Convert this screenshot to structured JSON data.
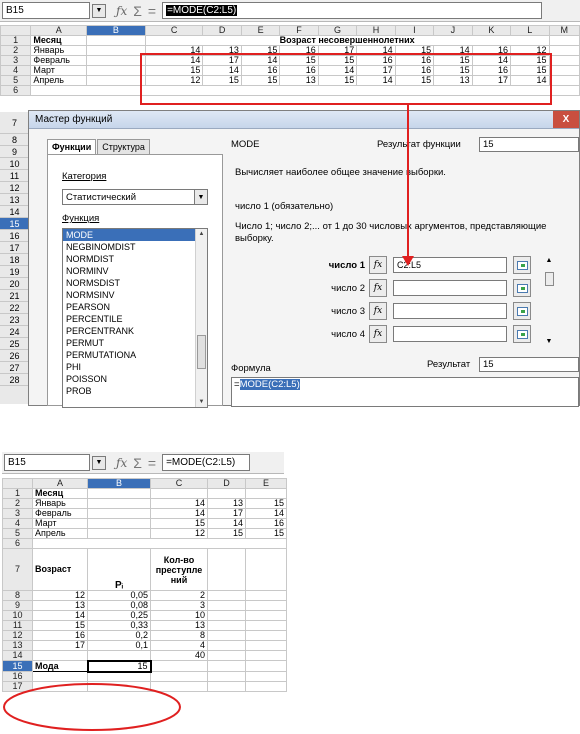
{
  "top_sheet": {
    "cell_ref": "B15",
    "formula": "=MODE(C2:L5)",
    "columns": [
      "A",
      "B",
      "C",
      "D",
      "E",
      "F",
      "G",
      "H",
      "I",
      "J",
      "K",
      "L",
      "M"
    ],
    "row_numbers": [
      "1",
      "2",
      "3",
      "4",
      "5",
      "6",
      "7",
      "8",
      "9",
      "10",
      "11",
      "12",
      "13",
      "14",
      "15",
      "16",
      "17",
      "18",
      "19",
      "20",
      "21",
      "22",
      "23",
      "24",
      "25",
      "26",
      "27",
      "28"
    ],
    "header_a1": "Месяц",
    "header_merged": "Возраст несовершеннолетних",
    "rows": [
      {
        "label": "Январь",
        "values": [
          "14",
          "13",
          "15",
          "16",
          "17",
          "14",
          "15",
          "14",
          "16",
          "12"
        ]
      },
      {
        "label": "Февраль",
        "values": [
          "14",
          "17",
          "14",
          "15",
          "15",
          "16",
          "16",
          "15",
          "14",
          "15"
        ]
      },
      {
        "label": "Март",
        "values": [
          "15",
          "14",
          "16",
          "16",
          "14",
          "17",
          "16",
          "15",
          "16",
          "15"
        ]
      },
      {
        "label": "Апрель",
        "values": [
          "12",
          "15",
          "15",
          "13",
          "15",
          "14",
          "15",
          "13",
          "17",
          "14"
        ]
      }
    ]
  },
  "dialog": {
    "title": "Мастер функций",
    "close": "X",
    "tabs": [
      "Функции",
      "Структура"
    ],
    "category_label": "Категория",
    "category_value": "Статистический",
    "function_label": "Функция",
    "functions": [
      "MODE",
      "NEGBINOMDIST",
      "NORMDIST",
      "NORMINV",
      "NORMSDIST",
      "NORMSINV",
      "PEARSON",
      "PERCENTILE",
      "PERCENTRANK",
      "PERMUT",
      "PERMUTATIONA",
      "PHI",
      "POISSON",
      "PROB"
    ],
    "function_name": "MODE",
    "result_label": "Результат функции",
    "result_value": "15",
    "description": "Вычисляет наиболее общее значение выборки.",
    "arg_title": "число 1 (обязательно)",
    "arg_description": "Число 1; число 2;... от 1 до 30 числовых аргументов, представляющие выборку.",
    "args": [
      {
        "label": "число 1",
        "value": "C2:L5"
      },
      {
        "label": "число 2",
        "value": ""
      },
      {
        "label": "число 3",
        "value": ""
      },
      {
        "label": "число 4",
        "value": ""
      }
    ],
    "fx": "fx",
    "formula_label": "Формула",
    "formula_result_label": "Результат",
    "formula_result_value": "15",
    "formula_eq": "=",
    "formula_text": "MODE(C2:L5)"
  },
  "bottom_sheet": {
    "cell_ref": "B15",
    "formula": "=MODE(C2:L5)",
    "columns": [
      "A",
      "B",
      "C",
      "D",
      "E"
    ],
    "header_a1": "Месяц",
    "rows": [
      {
        "label": "Январь",
        "values": [
          "14",
          "13",
          "15"
        ]
      },
      {
        "label": "Февраль",
        "values": [
          "14",
          "17",
          "14"
        ]
      },
      {
        "label": "Март",
        "values": [
          "15",
          "14",
          "16"
        ]
      },
      {
        "label": "Апрель",
        "values": [
          "12",
          "15",
          "15"
        ]
      }
    ],
    "col_age": "Возраст",
    "col_p": "Pᵢ",
    "col_count": "Кол-во преступле ний",
    "data": [
      {
        "row": "8",
        "age": "12",
        "p": "0,05",
        "count": "2"
      },
      {
        "row": "9",
        "age": "13",
        "p": "0,08",
        "count": "3"
      },
      {
        "row": "10",
        "age": "14",
        "p": "0,25",
        "count": "10"
      },
      {
        "row": "11",
        "age": "15",
        "p": "0,33",
        "count": "13"
      },
      {
        "row": "12",
        "age": "16",
        "p": "0,2",
        "count": "8"
      },
      {
        "row": "13",
        "age": "17",
        "p": "0,1",
        "count": "4"
      }
    ],
    "total": "40",
    "mode_label": "Мода",
    "mode_value": "15"
  },
  "colors": {
    "accent": "#3a6fb8",
    "highlight": "#e02020"
  },
  "icons": [
    "fx-icon",
    "sigma-icon",
    "shrink-icon",
    "dropdown-icon"
  ]
}
